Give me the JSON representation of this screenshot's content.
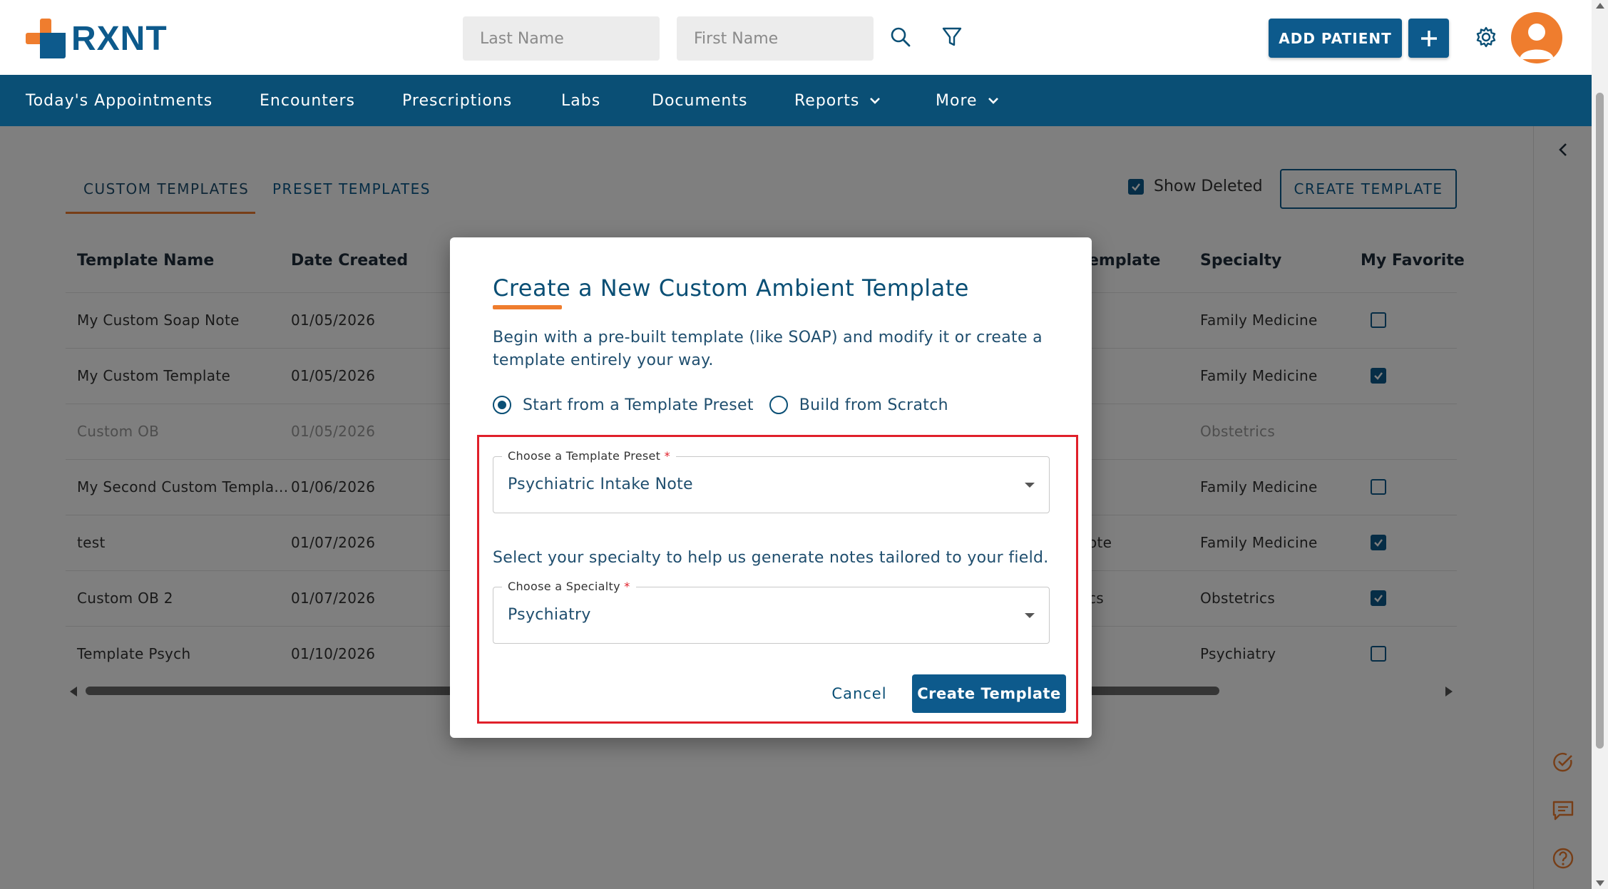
{
  "header": {
    "logo_text": "RXNT",
    "search": {
      "last_name_placeholder": "Last Name",
      "first_name_placeholder": "First Name"
    },
    "add_patient_label": "ADD PATIENT",
    "icons": [
      "search-icon",
      "filter-icon",
      "plus-icon",
      "gear-icon",
      "avatar"
    ]
  },
  "nav": {
    "items": [
      {
        "label": "Today's Appointments"
      },
      {
        "label": "Encounters"
      },
      {
        "label": "Prescriptions"
      },
      {
        "label": "Labs"
      },
      {
        "label": "Documents"
      },
      {
        "label": "Reports"
      },
      {
        "label": "More"
      }
    ]
  },
  "tabs": {
    "custom": "CUSTOM TEMPLATES",
    "preset": "PRESET TEMPLATES",
    "active": "CUSTOM TEMPLATES"
  },
  "toolbar": {
    "show_deleted_label": "Show Deleted",
    "show_deleted_checked": true,
    "create_template_label": "CREATE TEMPLATE"
  },
  "table": {
    "headers": {
      "name": "Template Name",
      "date": "Date Created",
      "template": "emplate",
      "specialty": "Specialty",
      "favorite": "My Favorite"
    },
    "rows": [
      {
        "name": "My Custom Soap Note",
        "date": "01/05/2026",
        "template": "",
        "specialty": "Family Medicine",
        "favorite": false,
        "deleted": false
      },
      {
        "name": "My Custom Template",
        "date": "01/05/2026",
        "template": "",
        "specialty": "Family Medicine",
        "favorite": true,
        "deleted": false
      },
      {
        "name": "Custom OB",
        "date": "01/05/2026",
        "template": "",
        "specialty": "Obstetrics",
        "favorite": null,
        "deleted": true
      },
      {
        "name": "My Second Custom Templa...",
        "date": "01/06/2026",
        "template": "",
        "specialty": "Family Medicine",
        "favorite": false,
        "deleted": false
      },
      {
        "name": "test",
        "date": "01/07/2026",
        "template": "ote",
        "specialty": "Family Medicine",
        "favorite": true,
        "deleted": false
      },
      {
        "name": "Custom OB 2",
        "date": "01/07/2026",
        "template": "cs",
        "specialty": "Obstetrics",
        "favorite": true,
        "deleted": false
      },
      {
        "name": "Template Psych",
        "date": "01/10/2026",
        "template": "",
        "specialty": "Psychiatry",
        "favorite": false,
        "deleted": false
      }
    ]
  },
  "modal": {
    "title": "Create a New Custom Ambient Template",
    "description": "Begin with a pre-built template (like SOAP) and modify it or create a template entirely your way.",
    "radio_preset": "Start from a Template Preset",
    "radio_scratch": "Build from Scratch",
    "selected_mode": "preset",
    "preset_label": "Choose a Template Preset",
    "preset_value": "Psychiatric Intake Note",
    "specialty_help": "Select your specialty to help us generate notes tailored to your field.",
    "specialty_label": "Choose a Specialty",
    "specialty_value": "Psychiatry",
    "required_mark": "*",
    "cancel_label": "Cancel",
    "create_label": "Create Template"
  },
  "colors": {
    "brand_blue": "#0d5a8c",
    "nav_blue": "#0a4f75",
    "accent_orange": "#ef7d2e",
    "highlight_red": "#e0202a"
  }
}
